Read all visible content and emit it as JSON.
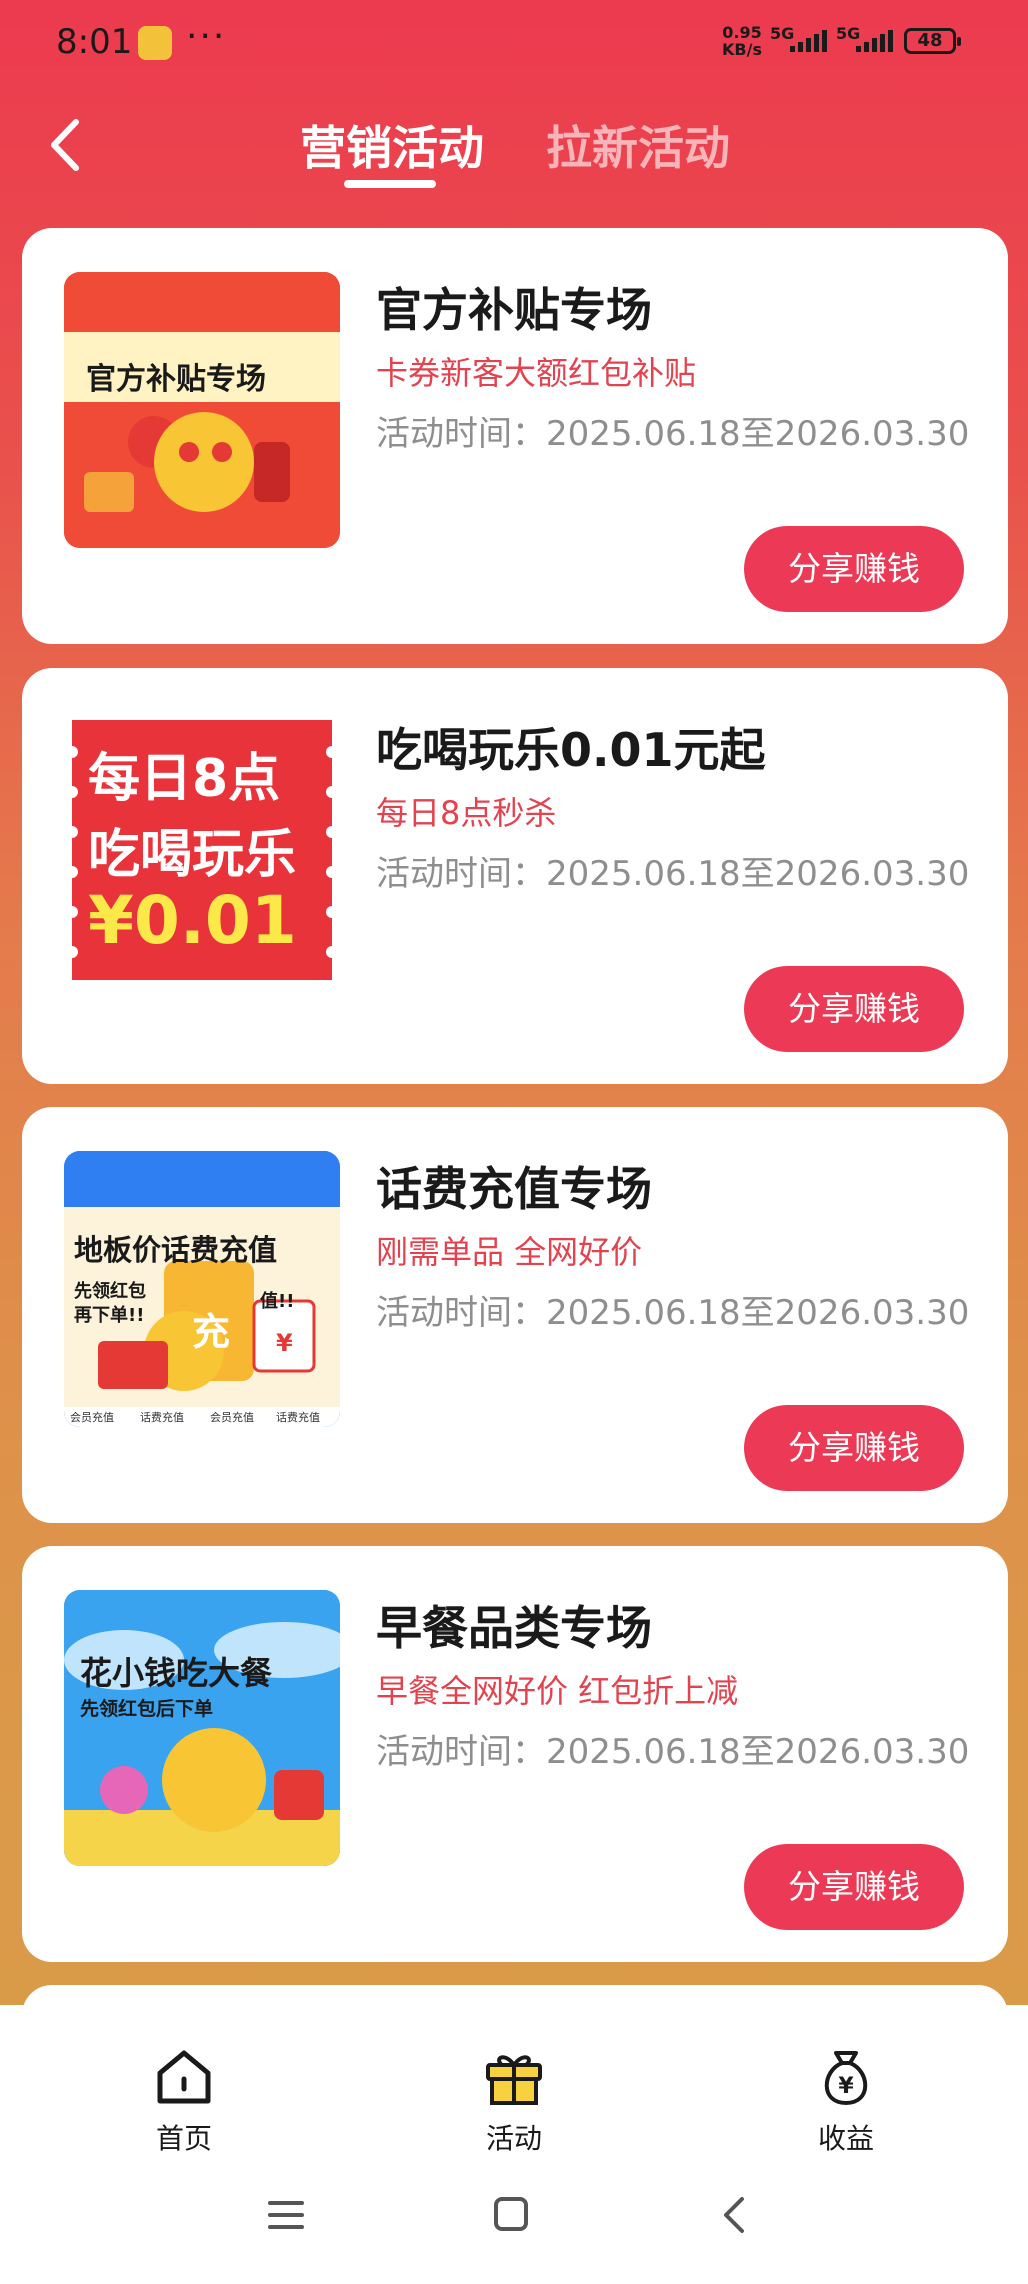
{
  "status_bar": {
    "time": "8:01",
    "net_speed_value": "0.95",
    "net_speed_unit": "KB/s",
    "signal1": "5G",
    "signal2": "5G",
    "battery": "48"
  },
  "header": {
    "tabs": [
      {
        "label": "营销活动",
        "active": true
      },
      {
        "label": "拉新活动",
        "active": false
      }
    ]
  },
  "cards": [
    {
      "title": "官方补贴专场",
      "subtitle": "卡券新客大额红包补贴",
      "time": "活动时间：2025.06.18至2026.03.30",
      "button": "分享赚钱",
      "thumb_text": [
        "官方补贴专场"
      ]
    },
    {
      "title": "吃喝玩乐0.01元起",
      "subtitle": "每日8点秒杀",
      "time": "活动时间：2025.06.18至2026.03.30",
      "button": "分享赚钱",
      "thumb_text": [
        "每日8点",
        "吃喝玩乐",
        "¥0.01"
      ]
    },
    {
      "title": "话费充值专场",
      "subtitle": "刚需单品 全网好价",
      "time": "活动时间：2025.06.18至2026.03.30",
      "button": "分享赚钱",
      "thumb_text": [
        "地板价话费充值",
        "先领红包",
        "再下单!!",
        "充",
        "值!!",
        "¥",
        "会员充值",
        "话费充值",
        "会员充值",
        "话费充值"
      ]
    },
    {
      "title": "早餐品类专场",
      "subtitle": "早餐全网好价 红包折上减",
      "time": "活动时间：2025.06.18至2026.03.30",
      "button": "分享赚钱",
      "thumb_text": [
        "花小钱吃大餐",
        "先领红包后下单"
      ]
    }
  ],
  "tab_bar": {
    "items": [
      {
        "label": "首页",
        "icon": "home-icon"
      },
      {
        "label": "活动",
        "icon": "gift-icon"
      },
      {
        "label": "收益",
        "icon": "money-bag-icon"
      }
    ]
  },
  "colors": {
    "accent": "#ec3a56",
    "subtitle": "#e2434f",
    "gradient_top": "#ec3a4f",
    "gradient_bottom": "#d99c48"
  }
}
